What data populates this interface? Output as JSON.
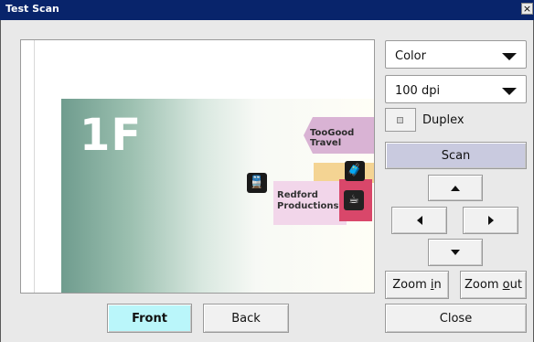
{
  "window": {
    "title": "Test Scan",
    "close_glyph": "×"
  },
  "preview": {
    "floor_label": "1F",
    "shop_label": "TooGood Travel",
    "production_label_line1": "Redford",
    "production_label_line2": "Productions"
  },
  "controls": {
    "color_mode": "Color",
    "resolution": "100 dpi",
    "duplex_label": "Duplex",
    "scan_label": "Scan",
    "zoom_in_prefix": "Zoom ",
    "zoom_in_key": "i",
    "zoom_in_suffix": "n",
    "zoom_out_prefix": "Zoom ",
    "zoom_out_key": "o",
    "zoom_out_suffix": "ut",
    "close_label": "Close"
  },
  "pages": {
    "front_label": "Front",
    "back_label": "Back",
    "selected": "Front"
  },
  "colors": {
    "title_bar": "#08246b",
    "active_tab": "#baf6fa",
    "scan_button": "#c9cadf"
  }
}
